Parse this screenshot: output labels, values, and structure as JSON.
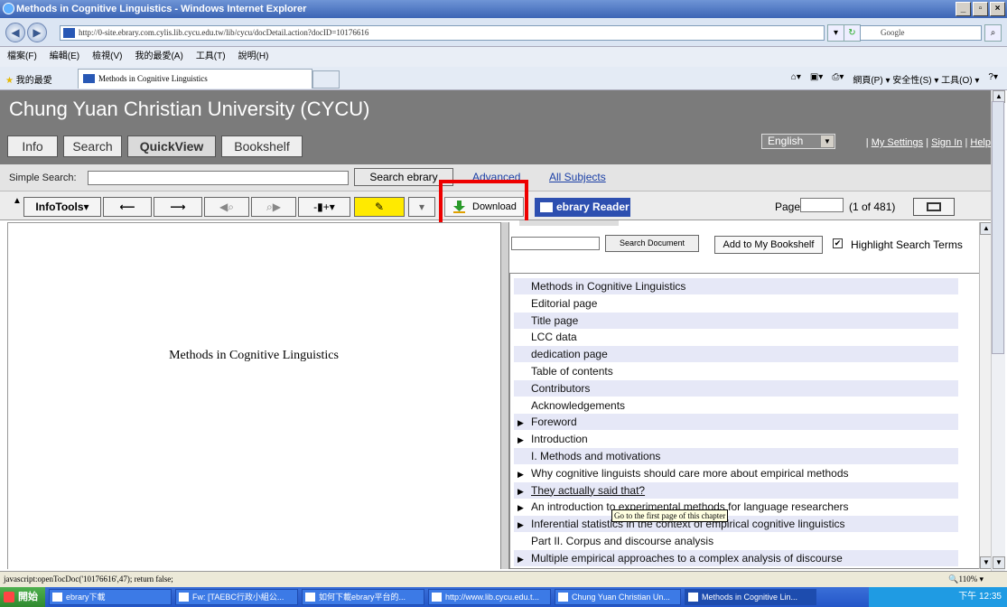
{
  "window": {
    "title": "Methods in Cognitive Linguistics - Windows Internet Explorer"
  },
  "address": {
    "url": "http://0-site.ebrary.com.cylis.lib.cycu.edu.tw/lib/cycu/docDetail.action?docID=10176616",
    "search_placeholder": "Google"
  },
  "menu": [
    "檔案(F)",
    "編輯(E)",
    "檢視(V)",
    "我的最愛(A)",
    "工具(T)",
    "說明(H)"
  ],
  "favorites": {
    "label": "我的最愛",
    "tab_title": "Methods in Cognitive Linguistics",
    "right_tools": "網頁(P) ▾   安全性(S) ▾   工具(O) ▾"
  },
  "header": {
    "university": "Chung Yuan Christian University (CYCU)",
    "nav": [
      "Info",
      "Search",
      "QuickView",
      "Bookshelf"
    ],
    "language": "English",
    "links": [
      "My Settings",
      "Sign In",
      "Help"
    ]
  },
  "search": {
    "label": "Simple Search:",
    "button": "Search ebrary",
    "advanced": "Advanced",
    "all_subjects": "All Subjects"
  },
  "toolbar": {
    "infotools": "InfoTools",
    "download": "Download",
    "reader": "ebrary Reader",
    "page_label": "Page",
    "page_count": "(1 of 481)"
  },
  "document": {
    "title": "Methods in Cognitive Linguistics"
  },
  "panel": {
    "search_button": "Search Document",
    "bookshelf_button": "Add to My Bookshelf",
    "highlight_label": "Highlight Search Terms",
    "toc": [
      {
        "label": "Methods in Cognitive Linguistics",
        "arrow": false
      },
      {
        "label": "Editorial page",
        "arrow": false
      },
      {
        "label": "Title page",
        "arrow": false
      },
      {
        "label": "LCC data",
        "arrow": false
      },
      {
        "label": "dedication page",
        "arrow": false
      },
      {
        "label": "Table of contents",
        "arrow": false
      },
      {
        "label": "Contributors",
        "arrow": false
      },
      {
        "label": "Acknowledgements",
        "arrow": false
      },
      {
        "label": "Foreword",
        "arrow": true
      },
      {
        "label": "Introduction",
        "arrow": true
      },
      {
        "label": "I. Methods and motivations",
        "arrow": false
      },
      {
        "label": "Why cognitive linguists should care more about empirical methods",
        "arrow": true
      },
      {
        "label": "They actually said that?",
        "arrow": true
      },
      {
        "label": "An introduction to experimental methods for language researchers",
        "arrow": true
      },
      {
        "label": "Inferential statistics in the context of empirical cognitive linguistics",
        "arrow": true
      },
      {
        "label": "Part II. Corpus and discourse analysis",
        "arrow": false
      },
      {
        "label": "Multiple empirical approaches to a complex analysis of discourse",
        "arrow": true
      }
    ],
    "tooltip": "Go to the first page of this chapter"
  },
  "status": {
    "text": "javascript:openTocDoc('10176616',47); return false;",
    "zoom": "110%"
  },
  "taskbar": {
    "start": "開始",
    "items": [
      "ebrary下載",
      "Fw: [TAEBC行政小組公...",
      "如何下載ebrary平台的...",
      "http://www.lib.cycu.edu.t...",
      "Chung Yuan Christian Un...",
      "Methods in Cognitive Lin..."
    ],
    "clock": "下午 12:35"
  }
}
